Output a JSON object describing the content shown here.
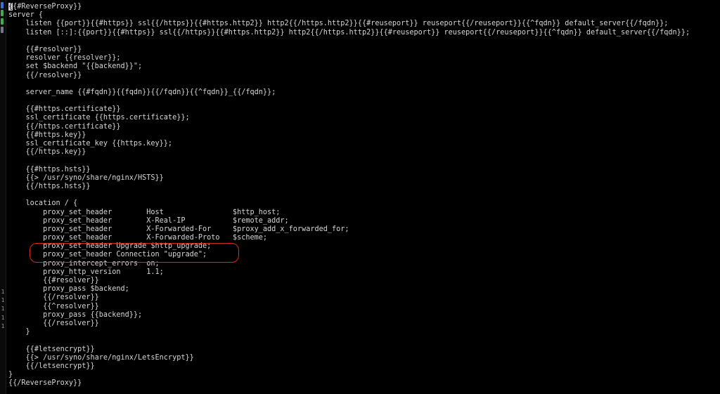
{
  "editor": {
    "cursor_char": "{",
    "first_line_rest": "{#ReverseProxy}}",
    "lines": [
      "server {",
      "    listen {{port}}{{#https}} ssl{{/https}}{{#https.http2}} http2{{/https.http2}}{{#reuseport}} reuseport{{/reuseport}}{{^fqdn}} default_server{{/fqdn}};",
      "    listen [::]:{{port}}{{#https}} ssl{{/https}}{{#https.http2}} http2{{/https.http2}}{{#reuseport}} reuseport{{/reuseport}}{{^fqdn}} default_server{{/fqdn}};",
      "",
      "    {{#resolver}}",
      "    resolver {{resolver}};",
      "    set $backend \"{{backend}}\";",
      "    {{/resolver}}",
      "",
      "    server_name {{#fqdn}}{{fqdn}}{{/fqdn}}{{^fqdn}}_{{/fqdn}};",
      "",
      "    {{#https.certificate}}",
      "    ssl_certificate {{https.certificate}};",
      "    {{/https.certificate}}",
      "    {{#https.key}}",
      "    ssl_certificate_key {{https.key}};",
      "    {{/https.key}}",
      "",
      "    {{#https.hsts}}",
      "    {{> /usr/syno/share/nginx/HSTS}}",
      "    {{/https.hsts}}",
      "",
      "    location / {",
      "        proxy_set_header        Host                $http_host;",
      "        proxy_set_header        X-Real-IP           $remote_addr;",
      "        proxy_set_header        X-Forwarded-For     $proxy_add_x_forwarded_for;",
      "        proxy_set_header        X-Forwarded-Proto   $scheme;",
      "        proxy_set_header Upgrade $http_upgrade;",
      "        proxy_set_header Connection \"upgrade\";",
      "        proxy_intercept_errors  on;",
      "        proxy_http_version      1.1;",
      "        {{#resolver}}",
      "        proxy_pass $backend;",
      "        {{/resolver}}",
      "        {{^resolver}}",
      "        proxy_pass {{backend}};",
      "        {{/resolver}}",
      "    }",
      "",
      "    {{#letsencrypt}}",
      "    {{> /usr/syno/share/nginx/LetsEncrypt}}",
      "    {{/letsencrypt}}",
      "}",
      "{{/ReverseProxy}}"
    ]
  },
  "gutter": {
    "markers": [
      "1",
      "1",
      "1",
      "1",
      "1"
    ]
  },
  "colors": {
    "background": "#000000",
    "text": "#d6d6d6",
    "annotation": "#d42a2a"
  }
}
